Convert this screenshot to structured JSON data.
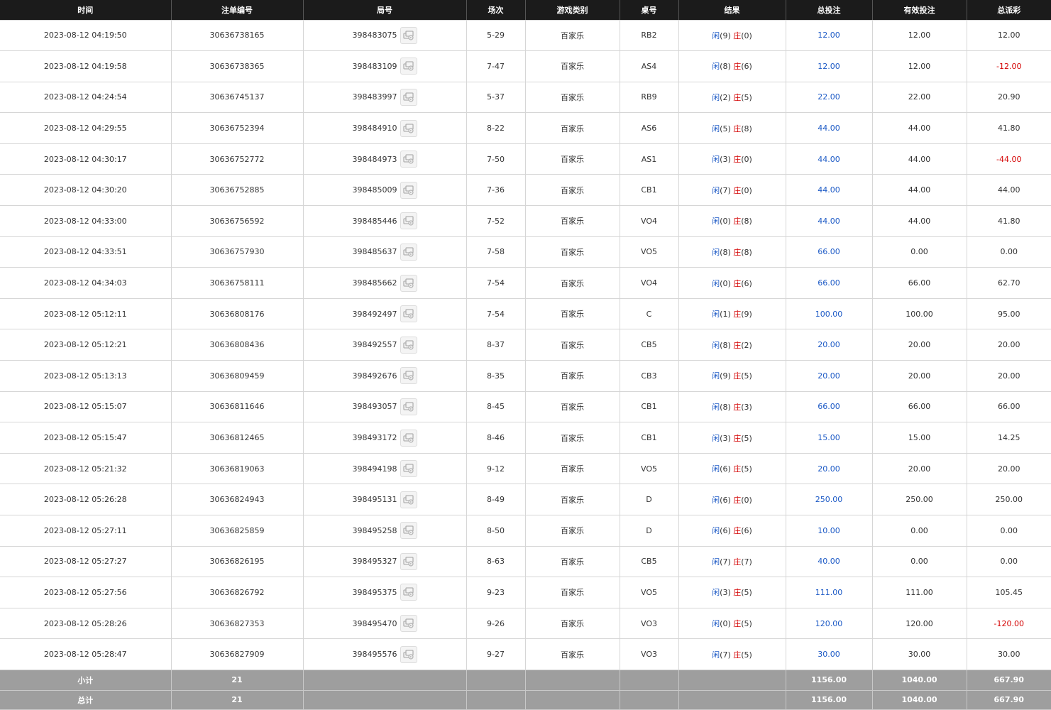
{
  "headers": {
    "time": "时间",
    "order_no": "注单编号",
    "round_id": "局号",
    "shoe": "场次",
    "game_type": "游戏类别",
    "table": "桌号",
    "result": "结果",
    "total_bet": "总投注",
    "valid_bet": "有效投注",
    "payout": "总派彩"
  },
  "labels": {
    "player": "闲",
    "banker": "庄"
  },
  "colors": {
    "header_bg": "#1b1b1b",
    "summary_bg": "#9e9e9e",
    "blue": "#1e5bc6",
    "red": "#d40000"
  },
  "rows": [
    {
      "time": "2023-08-12 04:19:50",
      "order_no": "30636738165",
      "round_id": "398483075",
      "shoe": "5-29",
      "game": "百家乐",
      "table": "RB2",
      "p": "(9)",
      "b": "(0)",
      "total_bet": "12.00",
      "valid_bet": "12.00",
      "payout": "12.00",
      "payout_negative": false
    },
    {
      "time": "2023-08-12 04:19:58",
      "order_no": "30636738365",
      "round_id": "398483109",
      "shoe": "7-47",
      "game": "百家乐",
      "table": "AS4",
      "p": "(8)",
      "b": "(6)",
      "total_bet": "12.00",
      "valid_bet": "12.00",
      "payout": "-12.00",
      "payout_negative": true
    },
    {
      "time": "2023-08-12 04:24:54",
      "order_no": "30636745137",
      "round_id": "398483997",
      "shoe": "5-37",
      "game": "百家乐",
      "table": "RB9",
      "p": "(2)",
      "b": "(5)",
      "total_bet": "22.00",
      "valid_bet": "22.00",
      "payout": "20.90",
      "payout_negative": false
    },
    {
      "time": "2023-08-12 04:29:55",
      "order_no": "30636752394",
      "round_id": "398484910",
      "shoe": "8-22",
      "game": "百家乐",
      "table": "AS6",
      "p": "(5)",
      "b": "(8)",
      "total_bet": "44.00",
      "valid_bet": "44.00",
      "payout": "41.80",
      "payout_negative": false
    },
    {
      "time": "2023-08-12 04:30:17",
      "order_no": "30636752772",
      "round_id": "398484973",
      "shoe": "7-50",
      "game": "百家乐",
      "table": "AS1",
      "p": "(3)",
      "b": "(0)",
      "total_bet": "44.00",
      "valid_bet": "44.00",
      "payout": "-44.00",
      "payout_negative": true
    },
    {
      "time": "2023-08-12 04:30:20",
      "order_no": "30636752885",
      "round_id": "398485009",
      "shoe": "7-36",
      "game": "百家乐",
      "table": "CB1",
      "p": "(7)",
      "b": "(0)",
      "total_bet": "44.00",
      "valid_bet": "44.00",
      "payout": "44.00",
      "payout_negative": false
    },
    {
      "time": "2023-08-12 04:33:00",
      "order_no": "30636756592",
      "round_id": "398485446",
      "shoe": "7-52",
      "game": "百家乐",
      "table": "VO4",
      "p": "(0)",
      "b": "(8)",
      "total_bet": "44.00",
      "valid_bet": "44.00",
      "payout": "41.80",
      "payout_negative": false
    },
    {
      "time": "2023-08-12 04:33:51",
      "order_no": "30636757930",
      "round_id": "398485637",
      "shoe": "7-58",
      "game": "百家乐",
      "table": "VO5",
      "p": "(8)",
      "b": "(8)",
      "total_bet": "66.00",
      "valid_bet": "0.00",
      "payout": "0.00",
      "payout_negative": false
    },
    {
      "time": "2023-08-12 04:34:03",
      "order_no": "30636758111",
      "round_id": "398485662",
      "shoe": "7-54",
      "game": "百家乐",
      "table": "VO4",
      "p": "(0)",
      "b": "(6)",
      "total_bet": "66.00",
      "valid_bet": "66.00",
      "payout": "62.70",
      "payout_negative": false
    },
    {
      "time": "2023-08-12 05:12:11",
      "order_no": "30636808176",
      "round_id": "398492497",
      "shoe": "7-54",
      "game": "百家乐",
      "table": "C",
      "p": "(1)",
      "b": "(9)",
      "total_bet": "100.00",
      "valid_bet": "100.00",
      "payout": "95.00",
      "payout_negative": false
    },
    {
      "time": "2023-08-12 05:12:21",
      "order_no": "30636808436",
      "round_id": "398492557",
      "shoe": "8-37",
      "game": "百家乐",
      "table": "CB5",
      "p": "(8)",
      "b": "(2)",
      "total_bet": "20.00",
      "valid_bet": "20.00",
      "payout": "20.00",
      "payout_negative": false
    },
    {
      "time": "2023-08-12 05:13:13",
      "order_no": "30636809459",
      "round_id": "398492676",
      "shoe": "8-35",
      "game": "百家乐",
      "table": "CB3",
      "p": "(9)",
      "b": "(5)",
      "total_bet": "20.00",
      "valid_bet": "20.00",
      "payout": "20.00",
      "payout_negative": false
    },
    {
      "time": "2023-08-12 05:15:07",
      "order_no": "30636811646",
      "round_id": "398493057",
      "shoe": "8-45",
      "game": "百家乐",
      "table": "CB1",
      "p": "(8)",
      "b": "(3)",
      "total_bet": "66.00",
      "valid_bet": "66.00",
      "payout": "66.00",
      "payout_negative": false
    },
    {
      "time": "2023-08-12 05:15:47",
      "order_no": "30636812465",
      "round_id": "398493172",
      "shoe": "8-46",
      "game": "百家乐",
      "table": "CB1",
      "p": "(3)",
      "b": "(5)",
      "total_bet": "15.00",
      "valid_bet": "15.00",
      "payout": "14.25",
      "payout_negative": false
    },
    {
      "time": "2023-08-12 05:21:32",
      "order_no": "30636819063",
      "round_id": "398494198",
      "shoe": "9-12",
      "game": "百家乐",
      "table": "VO5",
      "p": "(6)",
      "b": "(5)",
      "total_bet": "20.00",
      "valid_bet": "20.00",
      "payout": "20.00",
      "payout_negative": false
    },
    {
      "time": "2023-08-12 05:26:28",
      "order_no": "30636824943",
      "round_id": "398495131",
      "shoe": "8-49",
      "game": "百家乐",
      "table": "D",
      "p": "(6)",
      "b": "(0)",
      "total_bet": "250.00",
      "valid_bet": "250.00",
      "payout": "250.00",
      "payout_negative": false
    },
    {
      "time": "2023-08-12 05:27:11",
      "order_no": "30636825859",
      "round_id": "398495258",
      "shoe": "8-50",
      "game": "百家乐",
      "table": "D",
      "p": "(6)",
      "b": "(6)",
      "total_bet": "10.00",
      "valid_bet": "0.00",
      "payout": "0.00",
      "payout_negative": false
    },
    {
      "time": "2023-08-12 05:27:27",
      "order_no": "30636826195",
      "round_id": "398495327",
      "shoe": "8-63",
      "game": "百家乐",
      "table": "CB5",
      "p": "(7)",
      "b": "(7)",
      "total_bet": "40.00",
      "valid_bet": "0.00",
      "payout": "0.00",
      "payout_negative": false
    },
    {
      "time": "2023-08-12 05:27:56",
      "order_no": "30636826792",
      "round_id": "398495375",
      "shoe": "9-23",
      "game": "百家乐",
      "table": "VO5",
      "p": "(3)",
      "b": "(5)",
      "total_bet": "111.00",
      "valid_bet": "111.00",
      "payout": "105.45",
      "payout_negative": false
    },
    {
      "time": "2023-08-12 05:28:26",
      "order_no": "30636827353",
      "round_id": "398495470",
      "shoe": "9-26",
      "game": "百家乐",
      "table": "VO3",
      "p": "(0)",
      "b": "(5)",
      "total_bet": "120.00",
      "valid_bet": "120.00",
      "payout": "-120.00",
      "payout_negative": true
    },
    {
      "time": "2023-08-12 05:28:47",
      "order_no": "30636827909",
      "round_id": "398495576",
      "shoe": "9-27",
      "game": "百家乐",
      "table": "VO3",
      "p": "(7)",
      "b": "(5)",
      "total_bet": "30.00",
      "valid_bet": "30.00",
      "payout": "30.00",
      "payout_negative": false
    }
  ],
  "subtotal": {
    "label": "小计",
    "count": "21",
    "total_bet": "1156.00",
    "valid_bet": "1040.00",
    "payout": "667.90"
  },
  "total": {
    "label": "总计",
    "count": "21",
    "total_bet": "1156.00",
    "valid_bet": "1040.00",
    "payout": "667.90"
  }
}
